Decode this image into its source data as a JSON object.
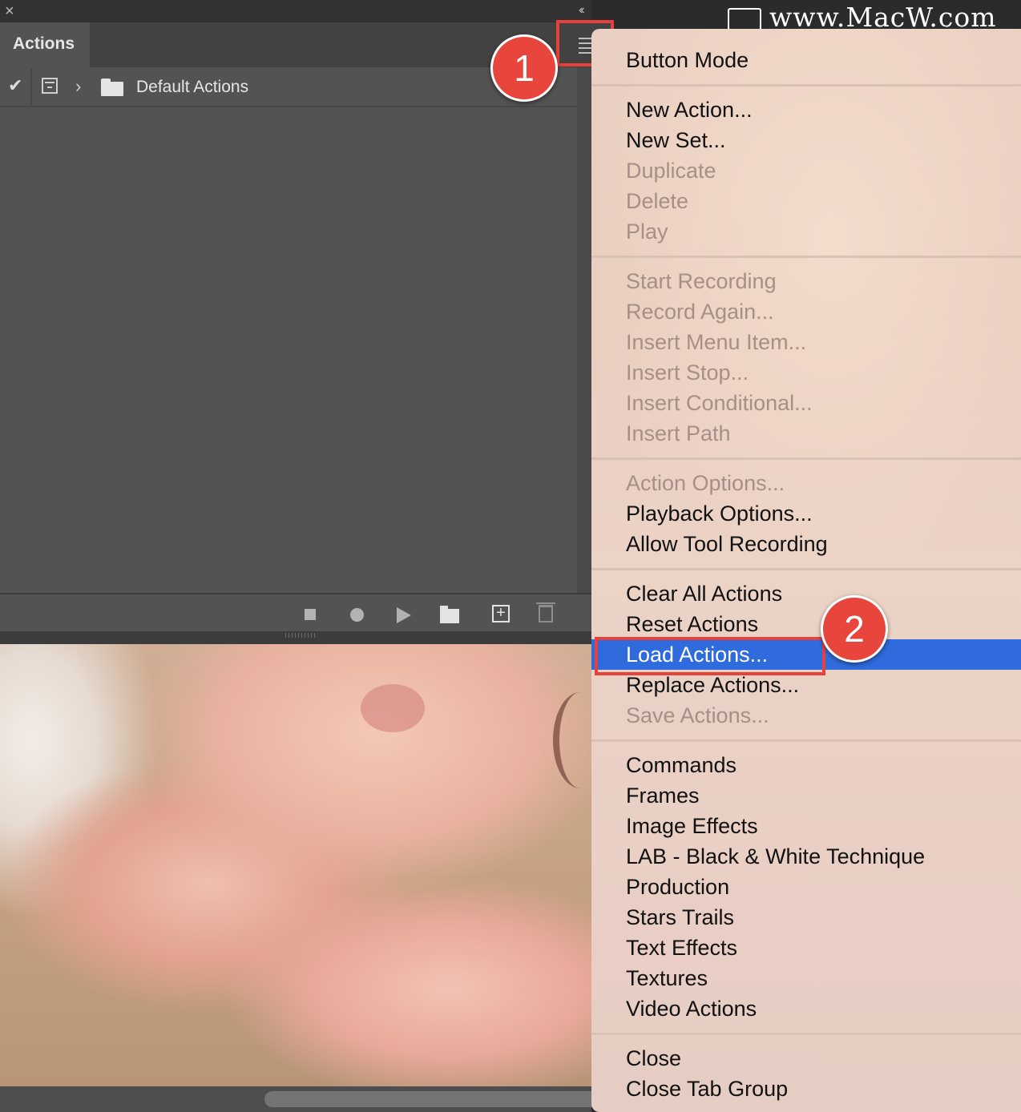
{
  "panel": {
    "close_glyph": "×",
    "collapse_glyph": "‹‹",
    "tab_label": "Actions",
    "action_set_name": "Default Actions",
    "check_glyph": "✔",
    "chevron_glyph": "›",
    "new_action_glyph": "+"
  },
  "watermark": {
    "text": "www.MacW.com"
  },
  "callouts": {
    "one": "1",
    "two": "2"
  },
  "menu": {
    "items": [
      {
        "label": "Button Mode",
        "enabled": true
      },
      {
        "label": "New Action...",
        "enabled": true
      },
      {
        "label": "New Set...",
        "enabled": true
      },
      {
        "label": "Duplicate",
        "enabled": false
      },
      {
        "label": "Delete",
        "enabled": false
      },
      {
        "label": "Play",
        "enabled": false
      },
      {
        "label": "Start Recording",
        "enabled": false
      },
      {
        "label": "Record Again...",
        "enabled": false
      },
      {
        "label": "Insert Menu Item...",
        "enabled": false
      },
      {
        "label": "Insert Stop...",
        "enabled": false
      },
      {
        "label": "Insert Conditional...",
        "enabled": false
      },
      {
        "label": "Insert Path",
        "enabled": false
      },
      {
        "label": "Action Options...",
        "enabled": false
      },
      {
        "label": "Playback Options...",
        "enabled": true
      },
      {
        "label": "Allow Tool Recording",
        "enabled": true
      },
      {
        "label": "Clear All Actions",
        "enabled": true
      },
      {
        "label": "Reset Actions",
        "enabled": true
      },
      {
        "label": "Load Actions...",
        "enabled": true,
        "selected": true
      },
      {
        "label": "Replace Actions...",
        "enabled": true
      },
      {
        "label": "Save Actions...",
        "enabled": false
      },
      {
        "label": "Commands",
        "enabled": true
      },
      {
        "label": "Frames",
        "enabled": true
      },
      {
        "label": "Image Effects",
        "enabled": true
      },
      {
        "label": "LAB - Black & White Technique",
        "enabled": true
      },
      {
        "label": "Production",
        "enabled": true
      },
      {
        "label": "Stars Trails",
        "enabled": true
      },
      {
        "label": "Text Effects",
        "enabled": true
      },
      {
        "label": "Textures",
        "enabled": true
      },
      {
        "label": "Video Actions",
        "enabled": true
      },
      {
        "label": "Close",
        "enabled": true
      },
      {
        "label": "Close Tab Group",
        "enabled": true
      }
    ]
  },
  "colors": {
    "highlight": "#2f6bdc",
    "callout": "#e8453c",
    "annotation_box": "#e8403a"
  }
}
